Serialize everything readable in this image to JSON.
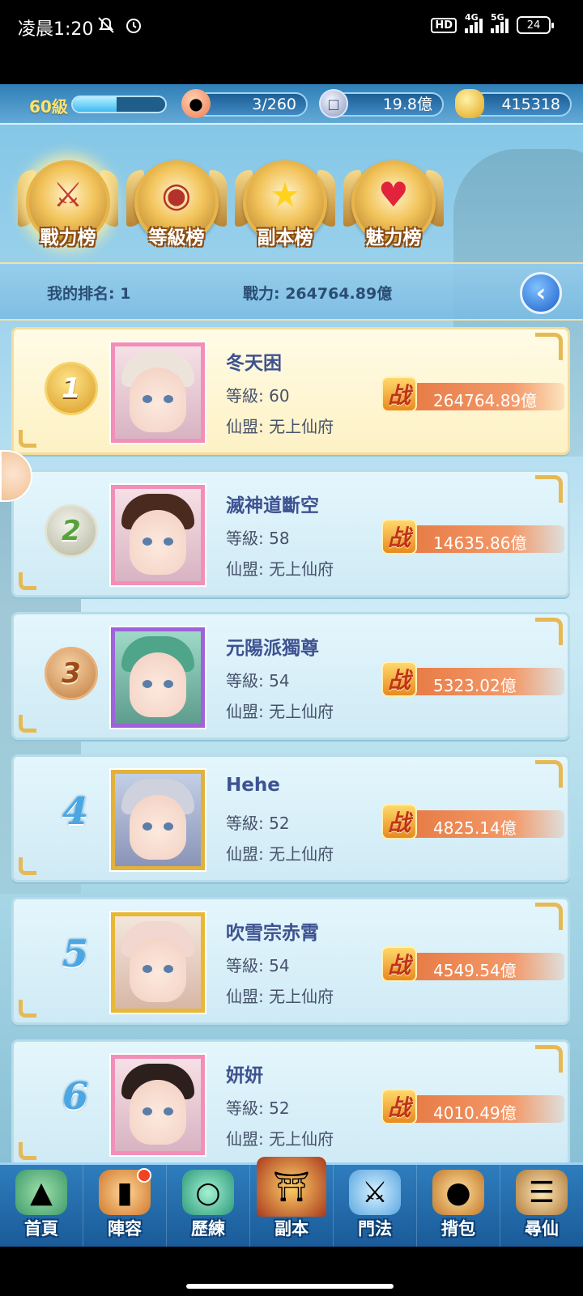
{
  "status_bar": {
    "time": "凌晨1:20",
    "hd_label": "HD",
    "net1": "4G",
    "net2": "5G",
    "battery": "24"
  },
  "resources": {
    "level": "60級",
    "xp_fraction": 0.47,
    "stamina": "3/260",
    "silver": "19.8億",
    "gold": "415318",
    "icons": [
      "peach-icon",
      "coin-icon",
      "gold-ingot-icon"
    ]
  },
  "tabs": [
    {
      "label": "戰力榜",
      "icon": "sword-emblem-icon",
      "active": true
    },
    {
      "label": "等級榜",
      "icon": "drum-emblem-icon",
      "active": false
    },
    {
      "label": "副本榜",
      "icon": "star-emblem-icon",
      "active": false
    },
    {
      "label": "魅力榜",
      "icon": "heart-emblem-icon",
      "active": false
    }
  ],
  "my_rank": {
    "rank_text": "我的排名: 1",
    "power_text": "戰力: 264764.89億"
  },
  "power_glyph": "战",
  "rankings": [
    {
      "rank": "1",
      "name": "冬天困",
      "level": "等級: 60",
      "guild": "仙盟: 无上仙府",
      "power": "264764.89億"
    },
    {
      "rank": "2",
      "name": "滅神道斷空",
      "level": "等級: 58",
      "guild": "仙盟: 无上仙府",
      "power": "14635.86億"
    },
    {
      "rank": "3",
      "name": "元陽派獨尊",
      "level": "等級: 54",
      "guild": "仙盟: 无上仙府",
      "power": "5323.02億"
    },
    {
      "rank": "4",
      "name": "Hehe",
      "level": "等級: 52",
      "guild": "仙盟: 无上仙府",
      "power": "4825.14億"
    },
    {
      "rank": "5",
      "name": "吹雪宗赤霄",
      "level": "等級: 54",
      "guild": "仙盟: 无上仙府",
      "power": "4549.54億"
    },
    {
      "rank": "6",
      "name": "妍妍",
      "level": "等級: 52",
      "guild": "仙盟: 无上仙府",
      "power": "4010.49億"
    }
  ],
  "bottom_nav": [
    {
      "label": "首頁",
      "icon": "home-island-icon"
    },
    {
      "label": "陣容",
      "icon": "cards-icon",
      "notification": true
    },
    {
      "label": "歷練",
      "icon": "jade-icon"
    },
    {
      "label": "副本",
      "icon": "gate-icon"
    },
    {
      "label": "門法",
      "icon": "sword-shrine-icon"
    },
    {
      "label": "揹包",
      "icon": "bag-icon"
    },
    {
      "label": "尋仙",
      "icon": "scroll-icon"
    }
  ]
}
